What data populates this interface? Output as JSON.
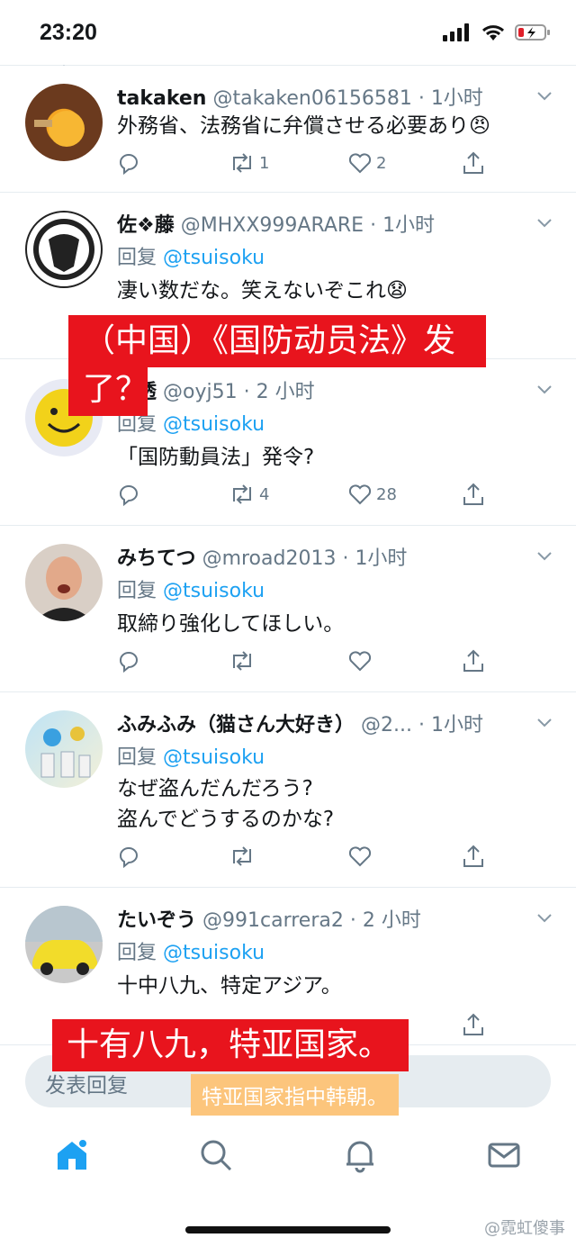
{
  "status_bar": {
    "time": "23:20"
  },
  "colors": {
    "accent": "#1da1f2",
    "muted": "#657786",
    "red_overlay": "#e8141d",
    "orange_overlay": "#fcc57c"
  },
  "tweets": [
    {
      "name": "takaken",
      "handle": "@takaken06156581",
      "time": "· 1小时",
      "reply_label": "",
      "mention": "",
      "text": "外務省、法務省に弁償させる必要あり😠",
      "replies": "",
      "retweets": "1",
      "likes": "2"
    },
    {
      "name": "佐❖藤",
      "handle": "@MHXX999ARARE",
      "time": "· 1小时",
      "reply_label": "回复",
      "mention": "@tsuisoku",
      "text": "凄い数だな。笑えないぞこれ😧",
      "replies": "",
      "retweets": "",
      "likes": ""
    },
    {
      "name": "河透",
      "handle": "@oyj51",
      "time": "· 2 小时",
      "reply_label": "回复",
      "mention": "@tsuisoku",
      "text": "「国防動員法」発令?",
      "replies": "",
      "retweets": "4",
      "likes": "28"
    },
    {
      "name": "みちてつ",
      "handle": "@mroad2013",
      "time": "· 1小时",
      "reply_label": "回复",
      "mention": "@tsuisoku",
      "text": "取締り強化してほしい。",
      "replies": "",
      "retweets": "",
      "likes": ""
    },
    {
      "name": "ふみふみ（猫さん大好き）",
      "handle": "@2...",
      "time": "· 1小时",
      "reply_label": "回复",
      "mention": "@tsuisoku",
      "text": "なぜ盗んだんだろう?\n盗んでどうするのかな?",
      "replies": "",
      "retweets": "",
      "likes": ""
    },
    {
      "name": "たいぞう",
      "handle": "@991carrera2",
      "time": "· 2 小时",
      "reply_label": "回复",
      "mention": "@tsuisoku",
      "text": "十中八九、特定アジア。",
      "replies": "",
      "retweets": "",
      "likes": ""
    }
  ],
  "overlays": {
    "caption1_line1": "（中国）《国防动员法》发",
    "caption1_line2": "了？",
    "caption2": "十有八九，特亚国家。",
    "caption3": "特亚国家指中韩朝。"
  },
  "compose": {
    "placeholder": "发表回复"
  },
  "tabs": [
    "home-icon",
    "search-icon",
    "notifications-icon",
    "messages-icon"
  ],
  "watermark": "@霓虹傻事"
}
